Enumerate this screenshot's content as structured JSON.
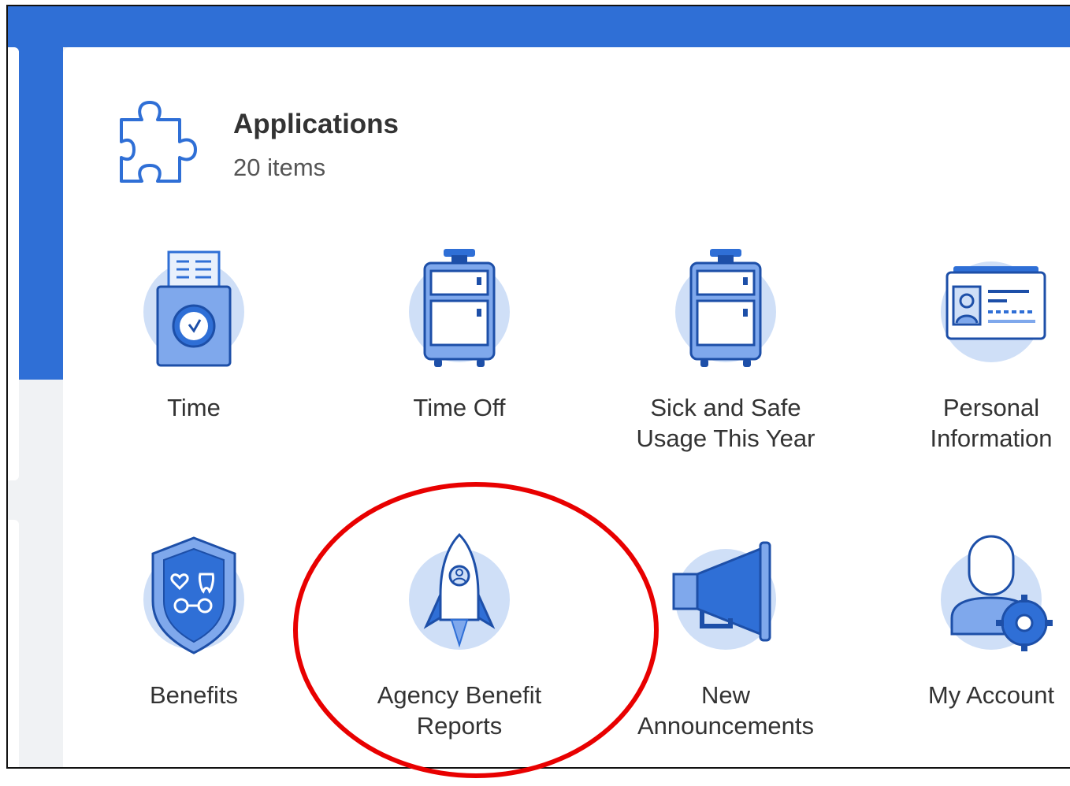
{
  "panel": {
    "title": "Applications",
    "subtitle": "20 items",
    "header_icon": "puzzle-icon"
  },
  "apps": [
    {
      "label_line1": "Time",
      "label_line2": "",
      "icon": "time-clock-icon"
    },
    {
      "label_line1": "Time Off",
      "label_line2": "",
      "icon": "suitcase-icon"
    },
    {
      "label_line1": "Sick and Safe",
      "label_line2": "Usage This Year",
      "icon": "suitcase-icon"
    },
    {
      "label_line1": "Personal",
      "label_line2": "Information",
      "icon": "id-card-icon"
    },
    {
      "label_line1": "Benefits",
      "label_line2": "",
      "icon": "shield-icon"
    },
    {
      "label_line1": "Agency Benefit",
      "label_line2": "Reports",
      "icon": "rocket-icon"
    },
    {
      "label_line1": "New",
      "label_line2": "Announcements",
      "icon": "megaphone-icon"
    },
    {
      "label_line1": "My Account",
      "label_line2": "",
      "icon": "user-gear-icon"
    }
  ],
  "colors": {
    "accent": "#2f6fd6",
    "icon_bg": "#cfdff7",
    "annotation": "#e80000"
  }
}
